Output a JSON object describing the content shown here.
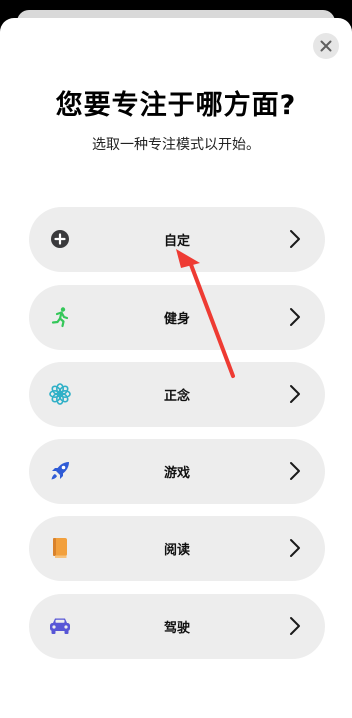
{
  "header": {
    "title": "您要专注于哪方面?",
    "subtitle": "选取一种专注模式以开始。"
  },
  "options": [
    {
      "label": "自定",
      "icon": "plus-circle-icon",
      "color": "#3a3a3c"
    },
    {
      "label": "健身",
      "icon": "running-figure-icon",
      "color": "#34c759"
    },
    {
      "label": "正念",
      "icon": "flower-icon",
      "color": "#30b0c7"
    },
    {
      "label": "游戏",
      "icon": "rocket-icon",
      "color": "#2f5bd6"
    },
    {
      "label": "阅读",
      "icon": "book-icon",
      "color": "#f2a03d"
    },
    {
      "label": "驾驶",
      "icon": "car-icon",
      "color": "#5856d6"
    }
  ],
  "annotation": {
    "color": "#ee3b33"
  }
}
